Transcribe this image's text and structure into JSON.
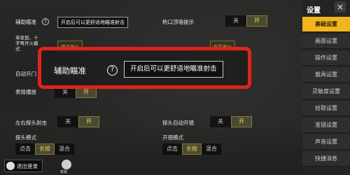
{
  "sidebar": {
    "title": "设置",
    "close": "×",
    "items": [
      {
        "label": "基础设置",
        "active": true
      },
      {
        "label": "画面设置",
        "active": false
      },
      {
        "label": "操作设置",
        "active": false
      },
      {
        "label": "载具设置",
        "active": false
      },
      {
        "label": "灵敏度设置",
        "active": false
      },
      {
        "label": "拾取设置",
        "active": false
      },
      {
        "label": "准镜设置",
        "active": false
      },
      {
        "label": "声音设置",
        "active": false
      },
      {
        "label": "快捷消息",
        "active": false
      }
    ]
  },
  "settings": {
    "aim_assist": {
      "label": "辅助瞄准",
      "hint": "开启后可以更舒适地瞄准射击"
    },
    "muzzle_hint": {
      "label": "枪口顶墙提示",
      "off": "关",
      "on": "开"
    },
    "single_shot": {
      "label": "单发狙、十字弩开火模式",
      "opt1": "按下开火",
      "opt2": "松手开火"
    },
    "auto_open_door": {
      "label": "自动开门"
    },
    "gesture": {
      "label": "表情播放",
      "off": "关",
      "on": "开"
    },
    "peek_fire": {
      "label": "左右探头射击",
      "off": "关",
      "on": "开"
    },
    "peek_auto": {
      "label": "探头自动开镜",
      "off": "关",
      "on": "开"
    },
    "peek_mode": {
      "label": "探头模式",
      "opt1": "点击",
      "opt2": "长按",
      "opt3": "混合"
    },
    "scope_mode": {
      "label": "开镜模式",
      "opt1": "点击",
      "opt2": "长按",
      "opt3": "混合"
    }
  },
  "bottom": {
    "logout": "退出登录",
    "service": "客服"
  }
}
